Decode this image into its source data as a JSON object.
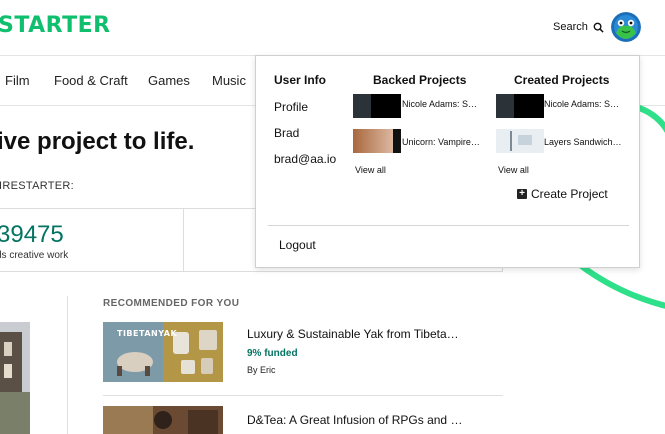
{
  "header": {
    "logo": "STARTER",
    "search_label": "Search",
    "search_icon": "search-icon",
    "avatar_icon": "avatar-icon"
  },
  "nav": {
    "categories": [
      "Film",
      "Food & Craft",
      "Games",
      "Music"
    ]
  },
  "hero": {
    "title": "ive project to life.",
    "subtitle": "IRESTARTER:",
    "stat_value": "39475",
    "stat_label": "ds creative work"
  },
  "recommended": {
    "heading": "RECOMMENDED FOR YOU",
    "items": [
      {
        "title": "Luxury & Sustainable Yak from Tibeta…",
        "thumb_text": "TIBETANYAK",
        "funded": "9% funded",
        "by": "By Eric"
      },
      {
        "title": "D&Tea: A Great Infusion of RPGs and …"
      }
    ]
  },
  "dropdown": {
    "user_info": {
      "heading": "User Info",
      "items": [
        "Profile",
        "Brad",
        "brad@aa.io"
      ]
    },
    "backed": {
      "heading": "Backed Projects",
      "items": [
        "Nicole Adams: S…",
        "Unicorn: Vampire…"
      ],
      "view_all": "View all"
    },
    "created": {
      "heading": "Created Projects",
      "items": [
        "Nicole Adams: S…",
        "Layers Sandwich…"
      ],
      "view_all": "View all"
    },
    "create_project": "Create Project",
    "logout": "Logout"
  },
  "colors": {
    "brand": "#0fbf6e",
    "accent_green": "#037362",
    "swoosh": "#2fe08a"
  }
}
